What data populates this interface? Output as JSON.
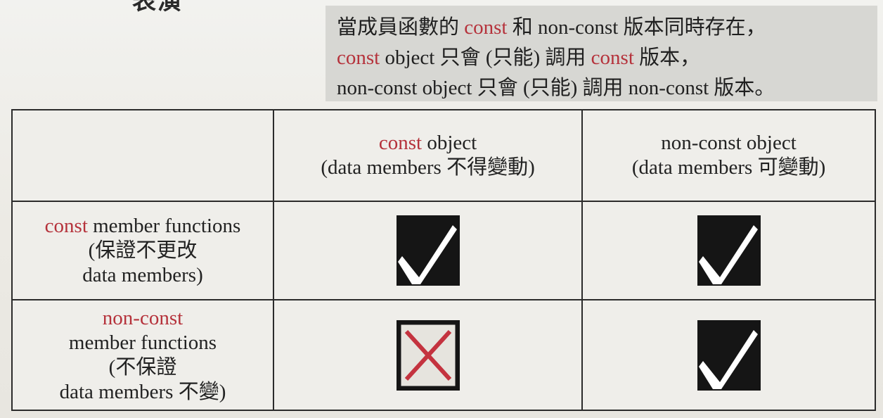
{
  "header_fragment": "表演",
  "note": {
    "line1": {
      "pre": "當成員函數的 ",
      "kw": "const",
      "post": " 和 non-const 版本同時存在，"
    },
    "line2": {
      "kw": "const",
      "mid": " object 只會 (只能) 調用 ",
      "kw2": "const",
      "post": " 版本，"
    },
    "line3": "non-const object 只會 (只能) 調用 non-const 版本。"
  },
  "table": {
    "columns": [
      {
        "kw": "const",
        "line1": " object",
        "line2": "(data members 不得變動)"
      },
      {
        "line1": "non-const object",
        "line2": "(data members 可變動)"
      }
    ],
    "rows": [
      {
        "kw": "const",
        "line1": " member functions",
        "line2": "(保證不更改",
        "line3": "data members)",
        "marks": [
          "check-icon",
          "check-icon"
        ]
      },
      {
        "line1": "non-const",
        "line2": "member functions",
        "line3": "(不保證",
        "line4": "data members 不變)",
        "marks": [
          "cross-icon",
          "check-icon"
        ]
      }
    ]
  },
  "colors": {
    "keyword": "#b5323b",
    "note_bg": "#d7d7d3",
    "cross": "#c4333f",
    "mark_dark": "#151515"
  }
}
